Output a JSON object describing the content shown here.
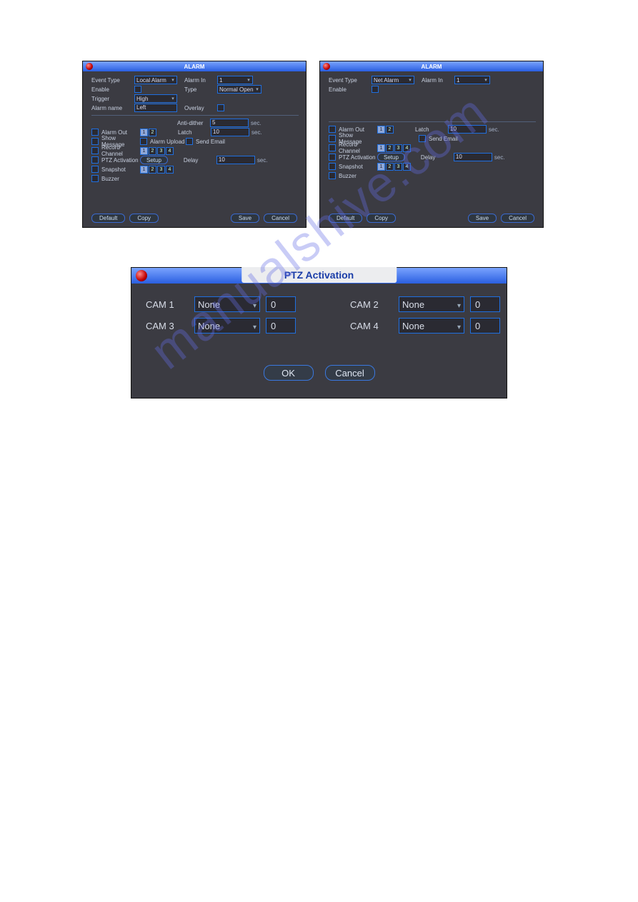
{
  "watermark": "manualshive.com",
  "alarm_title": "ALARM",
  "sec_label": "sec.",
  "labels": {
    "event_type": "Event Type",
    "enable": "Enable",
    "trigger": "Trigger",
    "alarm_name": "Alarm name",
    "alarm_in": "Alarm In",
    "type": "Type",
    "overlay": "Overlay",
    "anti_dither": "Anti-dither",
    "latch": "Latch",
    "alarm_out": "Alarm Out",
    "show_message": "Show Message",
    "record_channel": "Record Channel",
    "ptz_activation": "PTZ Activation",
    "snapshot": "Snapshot",
    "buzzer": "Buzzer",
    "alarm_upload": "Alarm Upload",
    "send_email": "Send Email",
    "delay": "Delay",
    "setup": "Setup",
    "default": "Default",
    "copy": "Copy",
    "save": "Save",
    "cancel": "Cancel"
  },
  "left": {
    "event_type": "Local Alarm",
    "alarm_in": "1",
    "type": "Normal Open",
    "trigger": "High",
    "alarm_name": "Left",
    "anti_dither": "5",
    "latch": "10",
    "delay": "10"
  },
  "right": {
    "event_type": "Net Alarm",
    "alarm_in": "1",
    "latch": "10",
    "delay": "10"
  },
  "ch": {
    "c1": "1",
    "c2": "2",
    "c3": "3",
    "c4": "4"
  },
  "ptz": {
    "title": "PTZ Activation",
    "cam1": "CAM 1",
    "cam2": "CAM 2",
    "cam3": "CAM 3",
    "cam4": "CAM 4",
    "none": "None",
    "zero": "0",
    "ok": "OK",
    "cancel": "Cancel"
  }
}
